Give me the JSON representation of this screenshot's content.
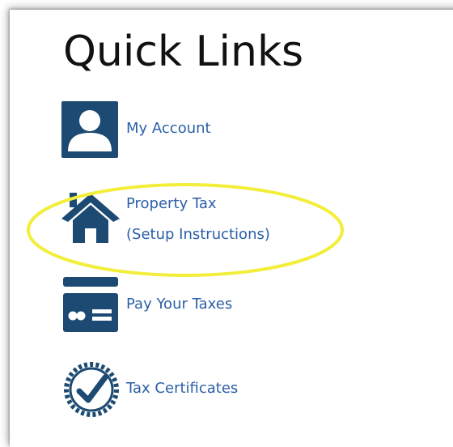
{
  "quick_links": {
    "title": "Quick Links",
    "items": [
      {
        "label": "My Account",
        "icon": "user-icon"
      },
      {
        "label_line1": "Property Tax",
        "label_line2": "(Setup Instructions)",
        "icon": "house-icon",
        "highlighted": true
      },
      {
        "label": "Pay Your Taxes",
        "icon": "card-icon"
      },
      {
        "label": "Tax Certificates",
        "icon": "certificate-check-icon"
      }
    ]
  },
  "colors": {
    "icon_navy": "#1c4a72",
    "link_blue": "#2b5fa6",
    "highlight_yellow": "#f2ee3a"
  }
}
